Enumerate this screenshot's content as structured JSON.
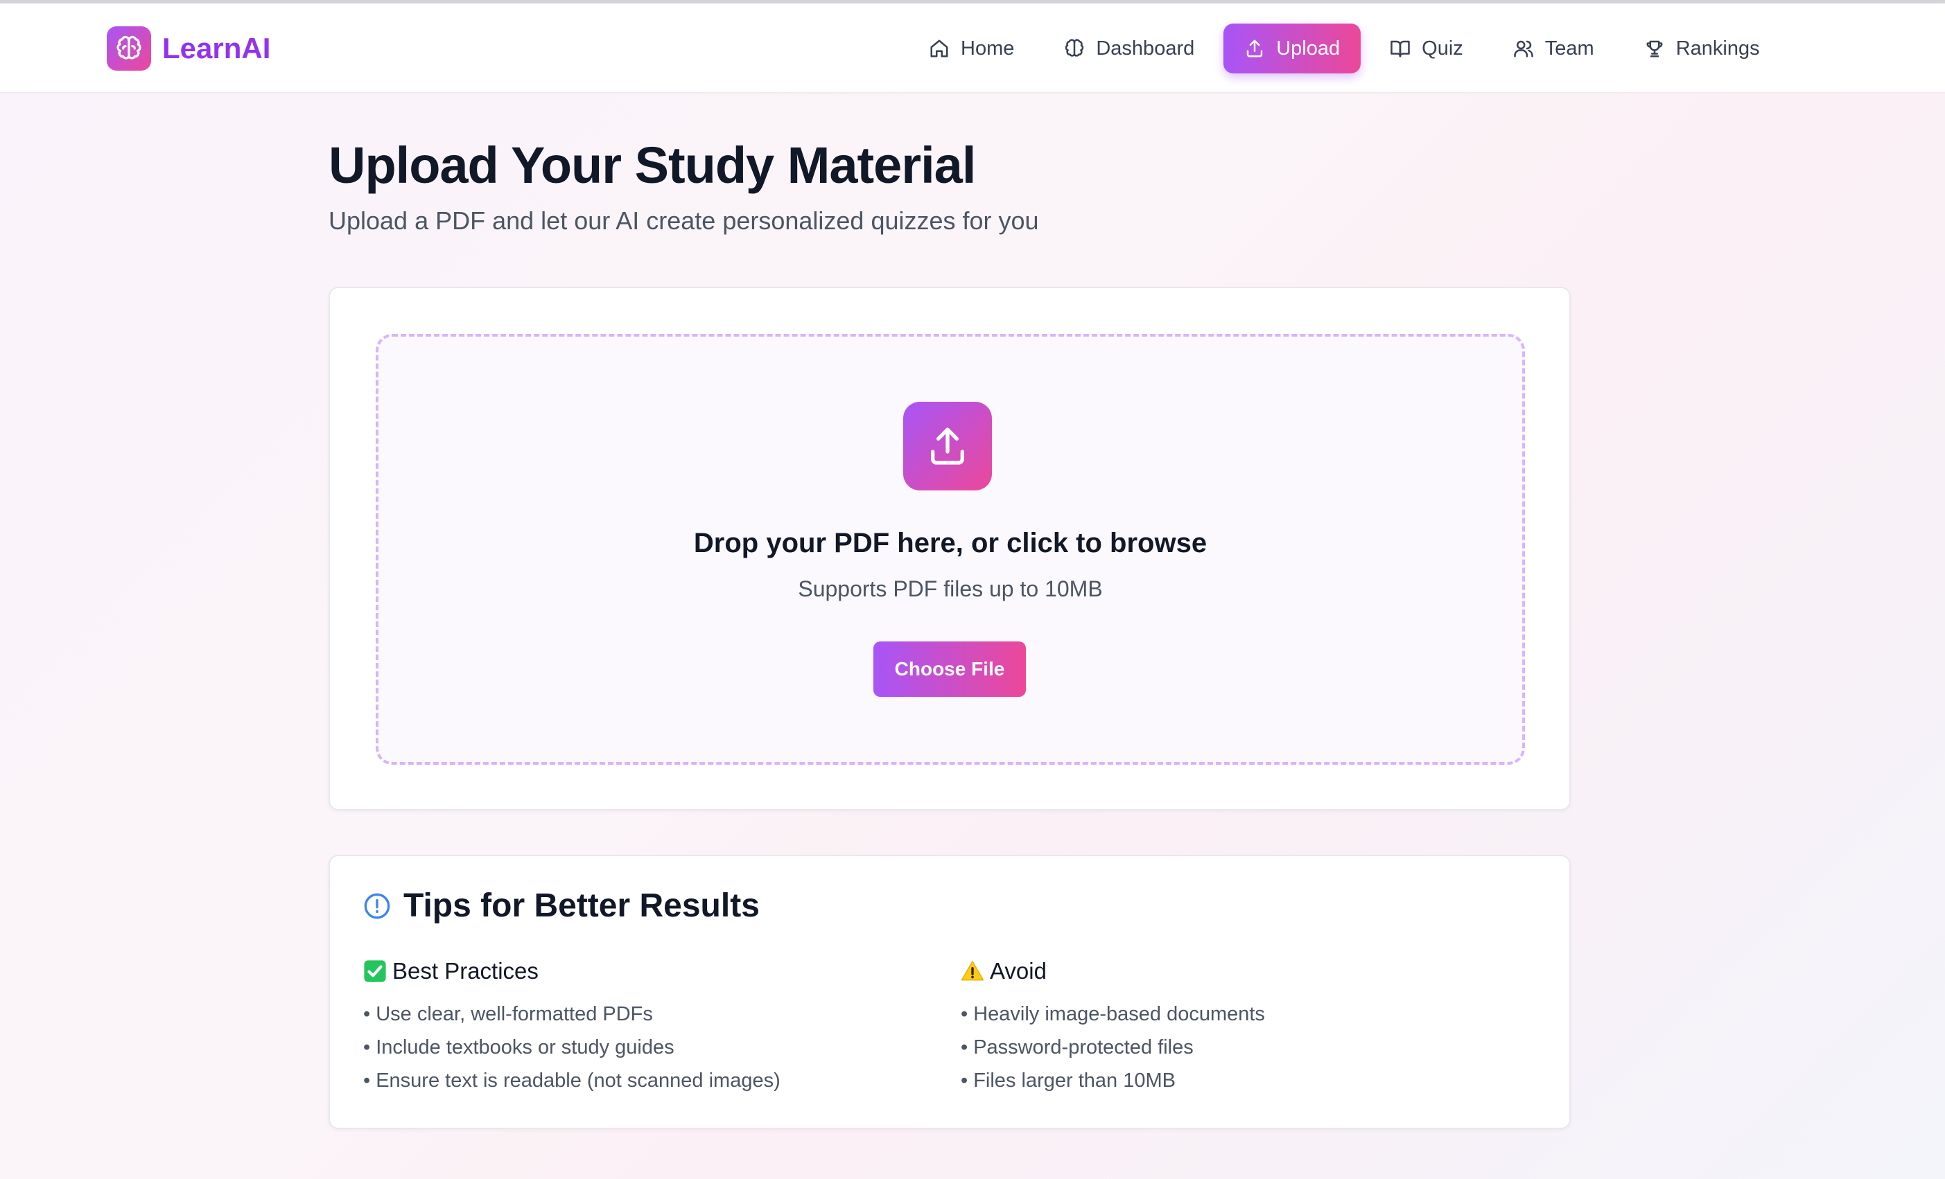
{
  "app": {
    "name": "LearnAI",
    "logo_icon": "brain-icon"
  },
  "nav": {
    "items": [
      {
        "label": "Home",
        "icon": "home-icon",
        "active": false
      },
      {
        "label": "Dashboard",
        "icon": "brain-icon",
        "active": false
      },
      {
        "label": "Upload",
        "icon": "upload-icon",
        "active": true
      },
      {
        "label": "Quiz",
        "icon": "book-open-icon",
        "active": false
      },
      {
        "label": "Team",
        "icon": "users-icon",
        "active": false
      },
      {
        "label": "Rankings",
        "icon": "trophy-icon",
        "active": false
      }
    ]
  },
  "page": {
    "title": "Upload Your Study Material",
    "subtitle": "Upload a PDF and let our AI create personalized quizzes for you"
  },
  "upload": {
    "icon": "upload-icon",
    "title": "Drop your PDF here, or click to browse",
    "subtitle": "Supports PDF files up to 10MB",
    "button_label": "Choose File"
  },
  "tips": {
    "icon": "info-icon",
    "title": "Tips for Better Results",
    "best": {
      "icon": "check-box-icon",
      "title": "Best Practices",
      "items": [
        "• Use clear, well-formatted PDFs",
        "• Include textbooks or study guides",
        "• Ensure text is readable (not scanned images)"
      ]
    },
    "avoid": {
      "icon": "warning-icon",
      "title": "Avoid",
      "items": [
        "• Heavily image-based documents",
        "• Password-protected files",
        "• Files larger than 10MB"
      ]
    }
  },
  "colors": {
    "accent_start": "#a855f7",
    "accent_end": "#ec4899",
    "brand_text": "#9333ea",
    "dropzone_border": "#d8b4fe",
    "info_blue": "#3b82f6"
  }
}
